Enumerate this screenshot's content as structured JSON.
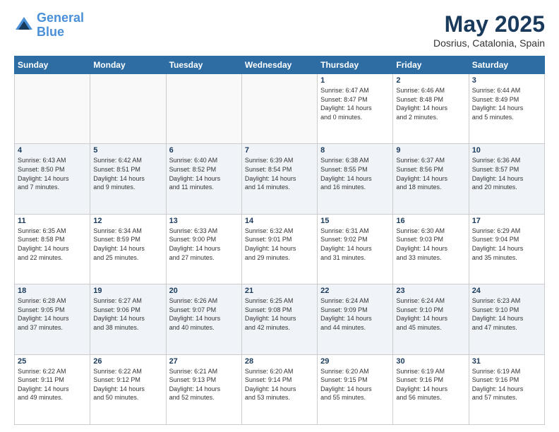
{
  "header": {
    "logo_line1": "General",
    "logo_line2": "Blue",
    "month": "May 2025",
    "location": "Dosrius, Catalonia, Spain"
  },
  "days_of_week": [
    "Sunday",
    "Monday",
    "Tuesday",
    "Wednesday",
    "Thursday",
    "Friday",
    "Saturday"
  ],
  "weeks": [
    [
      {
        "day": "",
        "info": ""
      },
      {
        "day": "",
        "info": ""
      },
      {
        "day": "",
        "info": ""
      },
      {
        "day": "",
        "info": ""
      },
      {
        "day": "1",
        "info": "Sunrise: 6:47 AM\nSunset: 8:47 PM\nDaylight: 14 hours\nand 0 minutes."
      },
      {
        "day": "2",
        "info": "Sunrise: 6:46 AM\nSunset: 8:48 PM\nDaylight: 14 hours\nand 2 minutes."
      },
      {
        "day": "3",
        "info": "Sunrise: 6:44 AM\nSunset: 8:49 PM\nDaylight: 14 hours\nand 5 minutes."
      }
    ],
    [
      {
        "day": "4",
        "info": "Sunrise: 6:43 AM\nSunset: 8:50 PM\nDaylight: 14 hours\nand 7 minutes."
      },
      {
        "day": "5",
        "info": "Sunrise: 6:42 AM\nSunset: 8:51 PM\nDaylight: 14 hours\nand 9 minutes."
      },
      {
        "day": "6",
        "info": "Sunrise: 6:40 AM\nSunset: 8:52 PM\nDaylight: 14 hours\nand 11 minutes."
      },
      {
        "day": "7",
        "info": "Sunrise: 6:39 AM\nSunset: 8:54 PM\nDaylight: 14 hours\nand 14 minutes."
      },
      {
        "day": "8",
        "info": "Sunrise: 6:38 AM\nSunset: 8:55 PM\nDaylight: 14 hours\nand 16 minutes."
      },
      {
        "day": "9",
        "info": "Sunrise: 6:37 AM\nSunset: 8:56 PM\nDaylight: 14 hours\nand 18 minutes."
      },
      {
        "day": "10",
        "info": "Sunrise: 6:36 AM\nSunset: 8:57 PM\nDaylight: 14 hours\nand 20 minutes."
      }
    ],
    [
      {
        "day": "11",
        "info": "Sunrise: 6:35 AM\nSunset: 8:58 PM\nDaylight: 14 hours\nand 22 minutes."
      },
      {
        "day": "12",
        "info": "Sunrise: 6:34 AM\nSunset: 8:59 PM\nDaylight: 14 hours\nand 25 minutes."
      },
      {
        "day": "13",
        "info": "Sunrise: 6:33 AM\nSunset: 9:00 PM\nDaylight: 14 hours\nand 27 minutes."
      },
      {
        "day": "14",
        "info": "Sunrise: 6:32 AM\nSunset: 9:01 PM\nDaylight: 14 hours\nand 29 minutes."
      },
      {
        "day": "15",
        "info": "Sunrise: 6:31 AM\nSunset: 9:02 PM\nDaylight: 14 hours\nand 31 minutes."
      },
      {
        "day": "16",
        "info": "Sunrise: 6:30 AM\nSunset: 9:03 PM\nDaylight: 14 hours\nand 33 minutes."
      },
      {
        "day": "17",
        "info": "Sunrise: 6:29 AM\nSunset: 9:04 PM\nDaylight: 14 hours\nand 35 minutes."
      }
    ],
    [
      {
        "day": "18",
        "info": "Sunrise: 6:28 AM\nSunset: 9:05 PM\nDaylight: 14 hours\nand 37 minutes."
      },
      {
        "day": "19",
        "info": "Sunrise: 6:27 AM\nSunset: 9:06 PM\nDaylight: 14 hours\nand 38 minutes."
      },
      {
        "day": "20",
        "info": "Sunrise: 6:26 AM\nSunset: 9:07 PM\nDaylight: 14 hours\nand 40 minutes."
      },
      {
        "day": "21",
        "info": "Sunrise: 6:25 AM\nSunset: 9:08 PM\nDaylight: 14 hours\nand 42 minutes."
      },
      {
        "day": "22",
        "info": "Sunrise: 6:24 AM\nSunset: 9:09 PM\nDaylight: 14 hours\nand 44 minutes."
      },
      {
        "day": "23",
        "info": "Sunrise: 6:24 AM\nSunset: 9:10 PM\nDaylight: 14 hours\nand 45 minutes."
      },
      {
        "day": "24",
        "info": "Sunrise: 6:23 AM\nSunset: 9:10 PM\nDaylight: 14 hours\nand 47 minutes."
      }
    ],
    [
      {
        "day": "25",
        "info": "Sunrise: 6:22 AM\nSunset: 9:11 PM\nDaylight: 14 hours\nand 49 minutes."
      },
      {
        "day": "26",
        "info": "Sunrise: 6:22 AM\nSunset: 9:12 PM\nDaylight: 14 hours\nand 50 minutes."
      },
      {
        "day": "27",
        "info": "Sunrise: 6:21 AM\nSunset: 9:13 PM\nDaylight: 14 hours\nand 52 minutes."
      },
      {
        "day": "28",
        "info": "Sunrise: 6:20 AM\nSunset: 9:14 PM\nDaylight: 14 hours\nand 53 minutes."
      },
      {
        "day": "29",
        "info": "Sunrise: 6:20 AM\nSunset: 9:15 PM\nDaylight: 14 hours\nand 55 minutes."
      },
      {
        "day": "30",
        "info": "Sunrise: 6:19 AM\nSunset: 9:16 PM\nDaylight: 14 hours\nand 56 minutes."
      },
      {
        "day": "31",
        "info": "Sunrise: 6:19 AM\nSunset: 9:16 PM\nDaylight: 14 hours\nand 57 minutes."
      }
    ]
  ]
}
